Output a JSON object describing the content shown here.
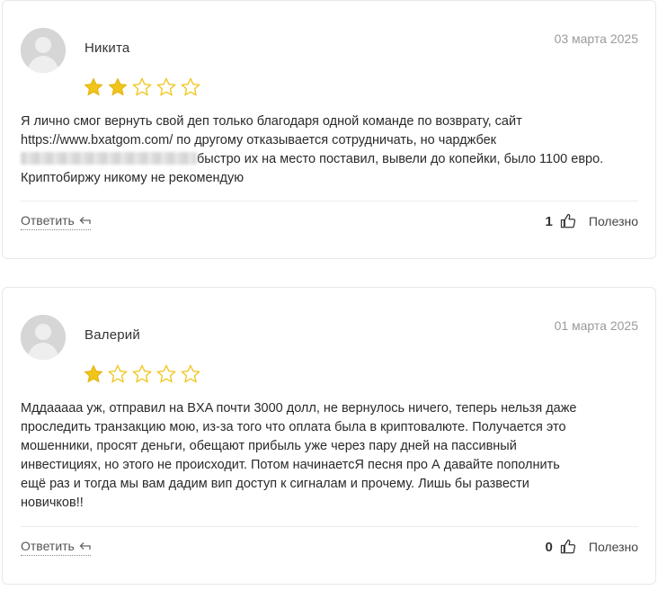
{
  "reviews": [
    {
      "author": "Никита",
      "date": "03 марта 2025",
      "rating": 2,
      "max_rating": 5,
      "text_lines": [
        "Я лично смог вернуть свой деп только благодаря одной команде по возврату, сайт",
        "https://www.bxatgom.com/ по другому отказывается сотрудничать, но чарджбек",
        "быстро их на место поставил, вывели до копейки, было 1100 евро.",
        "Криптобиржу никому не рекомендую"
      ],
      "reply_label": "Ответить",
      "likes": "1",
      "useful_label": "Полезно"
    },
    {
      "author": "Валерий",
      "date": "01 марта 2025",
      "rating": 1,
      "max_rating": 5,
      "text_lines": [
        "Мддааааа уж, отправил на BXA почти 3000 долл, не вернулось ничего, теперь нельзя даже",
        "проследить транзакцию мою, из-за того что оплата была в криптовалюте. Получается это",
        "мошенники, просят деньги, обещают прибыль уже через пару дней на пассивный",
        "инвестициях, но этого не происходит. Потом начинаетсЯ песня про А давайте пополнить",
        "ещё раз и тогда мы вам дадим вип доступ к сигналам и прочему. Лишь бы развести",
        "новичков!!"
      ],
      "reply_label": "Ответить",
      "likes": "0",
      "useful_label": "Полезно"
    }
  ],
  "colors": {
    "star_filled": "#f0c419",
    "star_empty_stroke": "#f0c419",
    "date": "#9a9a9a"
  },
  "icons": {
    "reply": "reply-arrow-icon",
    "like": "thumbs-up-icon",
    "avatar": "default-user-avatar"
  }
}
